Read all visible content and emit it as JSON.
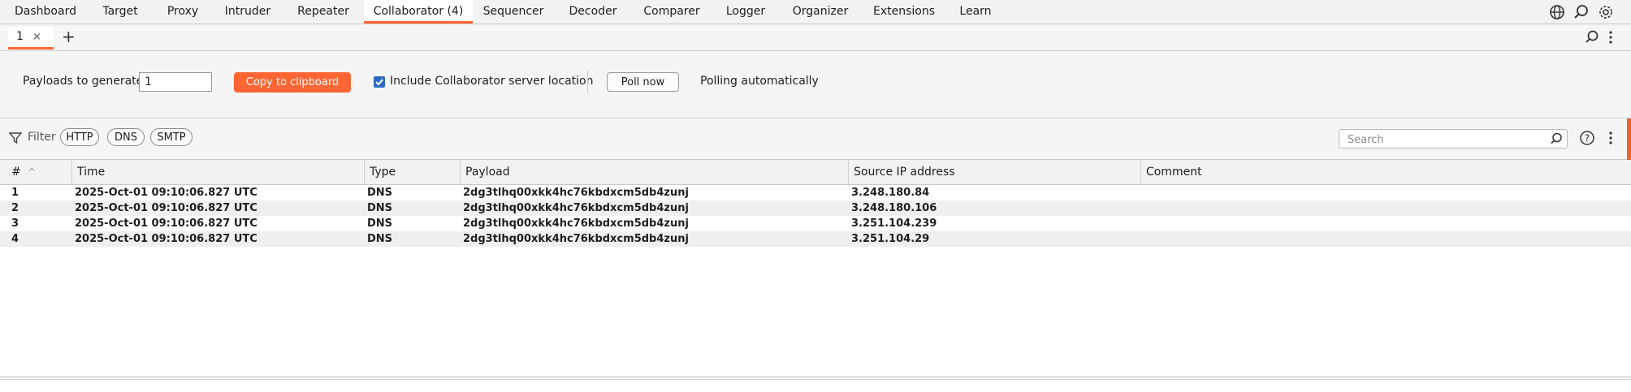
{
  "top_tabs": [
    "Dashboard",
    "Target",
    "Proxy",
    "Intruder",
    "Repeater",
    "Collaborator (4)",
    "Sequencer",
    "Decoder",
    "Comparer",
    "Logger",
    "Organizer",
    "Extensions",
    "Learn"
  ],
  "active_top_tab": "Collaborator (4)",
  "top_icons": [
    "globe-icon",
    "search-icon",
    "gear-icon"
  ],
  "sub_tabs": [
    {
      "label": "1",
      "close": "×"
    }
  ],
  "add_tab_label": "+",
  "controls": {
    "payloads_label": "Payloads to generate:",
    "payloads_value": "1",
    "copy_button": "Copy to clipboard",
    "include_location_label": "Include Collaborator server location",
    "include_location_checked": true,
    "poll_button": "Poll now",
    "polling_status": "Polling automatically"
  },
  "filter": {
    "label": "Filter",
    "pills": [
      "HTTP",
      "DNS",
      "SMTP"
    ],
    "search_placeholder": "Search"
  },
  "table": {
    "columns": [
      "#",
      "Time",
      "Type",
      "Payload",
      "Source IP address",
      "Comment"
    ],
    "sort_indicator": "^",
    "rows": [
      {
        "num": "1",
        "time": "2025-Oct-01 09:10:06.827 UTC",
        "type": "DNS",
        "payload": "2dg3tlhq00xkk4hc76kbdxcm5db4zunj",
        "source_ip": "3.248.180.84",
        "comment": ""
      },
      {
        "num": "2",
        "time": "2025-Oct-01 09:10:06.827 UTC",
        "type": "DNS",
        "payload": "2dg3tlhq00xkk4hc76kbdxcm5db4zunj",
        "source_ip": "3.248.180.106",
        "comment": ""
      },
      {
        "num": "3",
        "time": "2025-Oct-01 09:10:06.827 UTC",
        "type": "DNS",
        "payload": "2dg3tlhq00xkk4hc76kbdxcm5db4zunj",
        "source_ip": "3.251.104.239",
        "comment": ""
      },
      {
        "num": "4",
        "time": "2025-Oct-01 09:10:06.827 UTC",
        "type": "DNS",
        "payload": "2dg3tlhq00xkk4hc76kbdxcm5db4zunj",
        "source_ip": "3.251.104.29",
        "comment": ""
      }
    ]
  },
  "colors": {
    "accent": "#ff6633",
    "checkbox": "#2e6bbf"
  }
}
